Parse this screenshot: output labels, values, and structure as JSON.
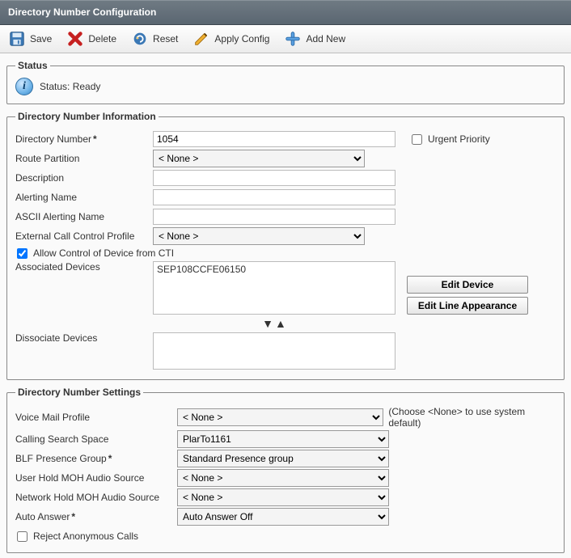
{
  "title": "Directory Number Configuration",
  "toolbar": {
    "save": "Save",
    "delete": "Delete",
    "reset": "Reset",
    "apply_config": "Apply Config",
    "add_new": "Add New"
  },
  "status": {
    "legend": "Status",
    "text": "Status: Ready"
  },
  "dn_info": {
    "legend": "Directory Number Information",
    "directory_number_label": "Directory Number",
    "directory_number_value": "1054",
    "urgent_priority_label": "Urgent Priority",
    "urgent_priority_checked": false,
    "route_partition_label": "Route Partition",
    "route_partition_value": "< None >",
    "description_label": "Description",
    "description_value": "",
    "alerting_name_label": "Alerting Name",
    "alerting_name_value": "",
    "ascii_alerting_name_label": "ASCII Alerting Name",
    "ascii_alerting_name_value": "",
    "ext_call_control_label": "External Call Control Profile",
    "ext_call_control_value": "< None >",
    "allow_cti_label": "Allow Control of Device from CTI",
    "allow_cti_checked": true,
    "associated_devices_label": "Associated Devices",
    "associated_device_item": "SEP108CCFE06150",
    "edit_device_label": "Edit Device",
    "edit_line_appearance_label": "Edit Line Appearance",
    "dissociate_devices_label": "Dissociate Devices"
  },
  "dn_settings": {
    "legend": "Directory Number Settings",
    "voice_mail_profile_label": "Voice Mail Profile",
    "voice_mail_profile_value": "< None >",
    "voice_mail_profile_hint": "(Choose <None> to use system default)",
    "calling_search_space_label": "Calling Search Space",
    "calling_search_space_value": "PlarTo1161",
    "blf_presence_group_label": "BLF Presence Group",
    "blf_presence_group_value": "Standard Presence group",
    "user_hold_moh_label": "User Hold MOH Audio Source",
    "user_hold_moh_value": "< None >",
    "network_hold_moh_label": "Network Hold MOH Audio Source",
    "network_hold_moh_value": "< None >",
    "auto_answer_label": "Auto Answer",
    "auto_answer_value": "Auto Answer Off",
    "reject_anon_label": "Reject Anonymous Calls",
    "reject_anon_checked": false
  }
}
